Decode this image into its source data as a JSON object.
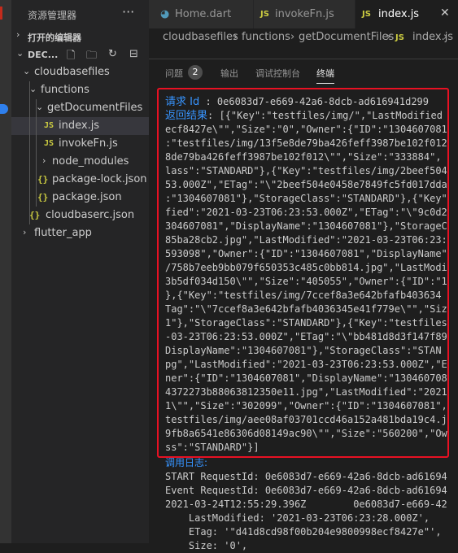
{
  "sidebar": {
    "title": "资源管理器",
    "more": "···",
    "open_editors": "打开的编辑器",
    "workspace": "DEC...",
    "tree": [
      {
        "label": "cloudbasefiles",
        "kind": "folder-open"
      },
      {
        "label": "functions",
        "kind": "folder-open"
      },
      {
        "label": "getDocumentFiles",
        "kind": "folder-open"
      },
      {
        "label": "index.js",
        "kind": "js",
        "badge": "JS",
        "selected": true
      },
      {
        "label": "invokeFn.js",
        "kind": "js",
        "badge": "JS"
      },
      {
        "label": "node_modules",
        "kind": "folder"
      },
      {
        "label": "package-lock.json",
        "kind": "json",
        "badge": "{}"
      },
      {
        "label": "package.json",
        "kind": "json",
        "badge": "{}"
      },
      {
        "label": "cloudbaserc.json",
        "kind": "json",
        "badge": "{}"
      },
      {
        "label": "flutter_app",
        "kind": "folder"
      }
    ]
  },
  "tabs": [
    {
      "label": "Home.dart",
      "badge": "◕"
    },
    {
      "label": "invokeFn.js",
      "badge": "JS"
    },
    {
      "label": "index.js",
      "badge": "JS",
      "active": true,
      "close": "✕"
    }
  ],
  "breadcrumb": [
    "cloudbasefiles",
    "functions",
    "getDocumentFiles",
    "JS",
    "index.js",
    "..."
  ],
  "panel": {
    "tabs": [
      "问题",
      "输出",
      "调试控制台",
      "终端"
    ],
    "problems_count": "2",
    "active_tab": "终端"
  },
  "terminal": {
    "request_label": "请求 Id",
    "request_id": ": 0e6083d7-e669-42a6-8dcb-ad616941d299",
    "result_label": "返回结果",
    "result_lines": [
      ": [{\"Key\":\"testfiles/img/\",\"LastModified",
      "ecf8427e\\\"\",\"Size\":\"0\",\"Owner\":{\"ID\":\"1304607081",
      ":\"testfiles/img/13f5e8de79ba426feff3987be102f012",
      "8de79ba426feff3987be102f012\\\"\",\"Size\":\"333884\",",
      "lass\":\"STANDARD\"},{\"Key\":\"testfiles/img/2beef504",
      "53.000Z\",\"ETag\":\"\\\"2beef504e0458e7849fc5fd017dda",
      ":\"1304607081\"},\"StorageClass\":\"STANDARD\"},{\"Key\"",
      "fied\":\"2021-03-23T06:23:53.000Z\",\"ETag\":\"\\\"9c0d2",
      "304607081\",\"DisplayName\":\"1304607081\"},\"StorageC",
      "85ba28cb2.jpg\",\"LastModified\":\"2021-03-23T06:23:",
      "593098\",\"Owner\":{\"ID\":\"1304607081\",\"DisplayName\"",
      "/758b7eeb9bb079f650353c485c0bb814.jpg\",\"LastModi",
      "3b5df034d150\\\"\",\"Size\":\"405055\",\"Owner\":{\"ID\":\"1",
      "},{\"Key\":\"testfiles/img/7ccef8a3e642bfafb403634",
      "Tag\":\"\\\"7ccef8a3e642bfafb4036345e41f779e\\\"\",\"Siz",
      "1\"},\"StorageClass\":\"STANDARD\"},{\"Key\":\"testfiles",
      "-03-23T06:23:53.000Z\",\"ETag\":\"\\\"bb481d8d3f147f89",
      "DisplayName\":\"1304607081\"},\"StorageClass\":\"STAN",
      "pg\",\"LastModified\":\"2021-03-23T06:23:53.000Z\",\"E",
      "ner\":{\"ID\":\"1304607081\",\"DisplayName\":\"130460708",
      "4372273b88063812350e11.jpg\",\"LastModified\":\"2021",
      "1\\\"\",\"Size\":\"302099\",\"Owner\":{\"ID\":\"1304607081\",",
      "testfiles/img/aee08af03701ccd46a152a481bda19c4.j",
      "9fb8a6541e86306d08149ac90\\\"\",\"Size\":\"560200\",\"Ow",
      "ss\":\"STANDARD\"}]"
    ],
    "log_label": "调用日志:",
    "log_lines": [
      "START RequestId: 0e6083d7-e669-42a6-8dcb-ad61694",
      "Event RequestId: 0e6083d7-e669-42a6-8dcb-ad61694",
      "2021-03-24T12:55:29.396Z        0e6083d7-e669-42",
      "    LastModified: '2021-03-23T06:23:28.000Z',",
      "    ETag: '\"d41d8cd98f00b204e9800998ecf8427e\"',",
      "    Size: '0',"
    ]
  },
  "colors": {
    "highlight": "#e81123",
    "accent": "#3794ff",
    "js_badge": "#cbcb41"
  }
}
